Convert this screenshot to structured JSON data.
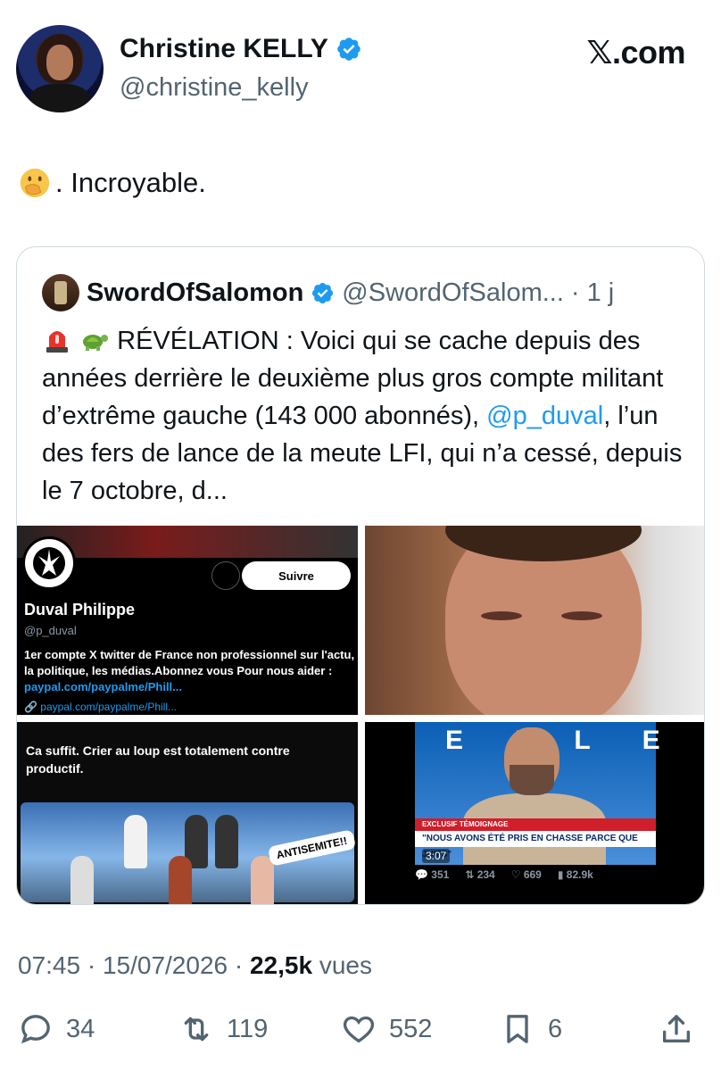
{
  "author": {
    "name": "Christine KELLY",
    "handle": "@christine_kelly"
  },
  "brand": "𝕏.com",
  "tweet_text": ". Incroyable.",
  "quote": {
    "name": "SwordOfSalomon",
    "handle": "@SwordOfSalom...",
    "dot": "·",
    "time": "1 j",
    "text_before": "RÉVÉLATION : Voici qui se cache depuis des années derrière le deuxième plus gros compte militant d’extrême gauche (143 000 abonnés), ",
    "mention": "@p_duval",
    "text_after": ", l’un des fers de lance de la meute LFI, qui n’a cessé, depuis le 7 octobre, d...",
    "media": {
      "profile": {
        "follow": "Suivre",
        "name": "Duval Philippe",
        "handle": "@p_duval",
        "bio": "1er compte X twitter de France non professionnel sur l'actu, la politique, les médias.Abonnez vous Pour nous aider : ",
        "bio_link": "paypal.com/paypalme/Phill...",
        "link": "🔗 paypal.com/paypalme/Phill..."
      },
      "cartoon": {
        "caption": "Ca suffit. Crier au loup est totalement contre productif.",
        "stamp": "ANTISEMITE!!"
      },
      "video": {
        "letters": "EILE",
        "lower": "EXCLUSIF TÉMOIGNAGE",
        "chyron": "\"NOUS AVONS ÉTÉ PRIS EN CHASSE PARCE QUE JUIFS\"",
        "duration": "3:07",
        "replies": "351",
        "reposts": "234",
        "likes": "669",
        "views": "82.9k"
      }
    }
  },
  "meta": {
    "time_date": "07:45 · 15/07/2026 · ",
    "views_count": "22,5k",
    "views_label": " vues"
  },
  "actions": {
    "replies": "34",
    "reposts": "119",
    "likes": "552",
    "bookmarks": "6"
  },
  "colors": {
    "text": "#0f1419",
    "muted": "#536471",
    "accent": "#1d9bf0",
    "border": "#cfd9de"
  }
}
